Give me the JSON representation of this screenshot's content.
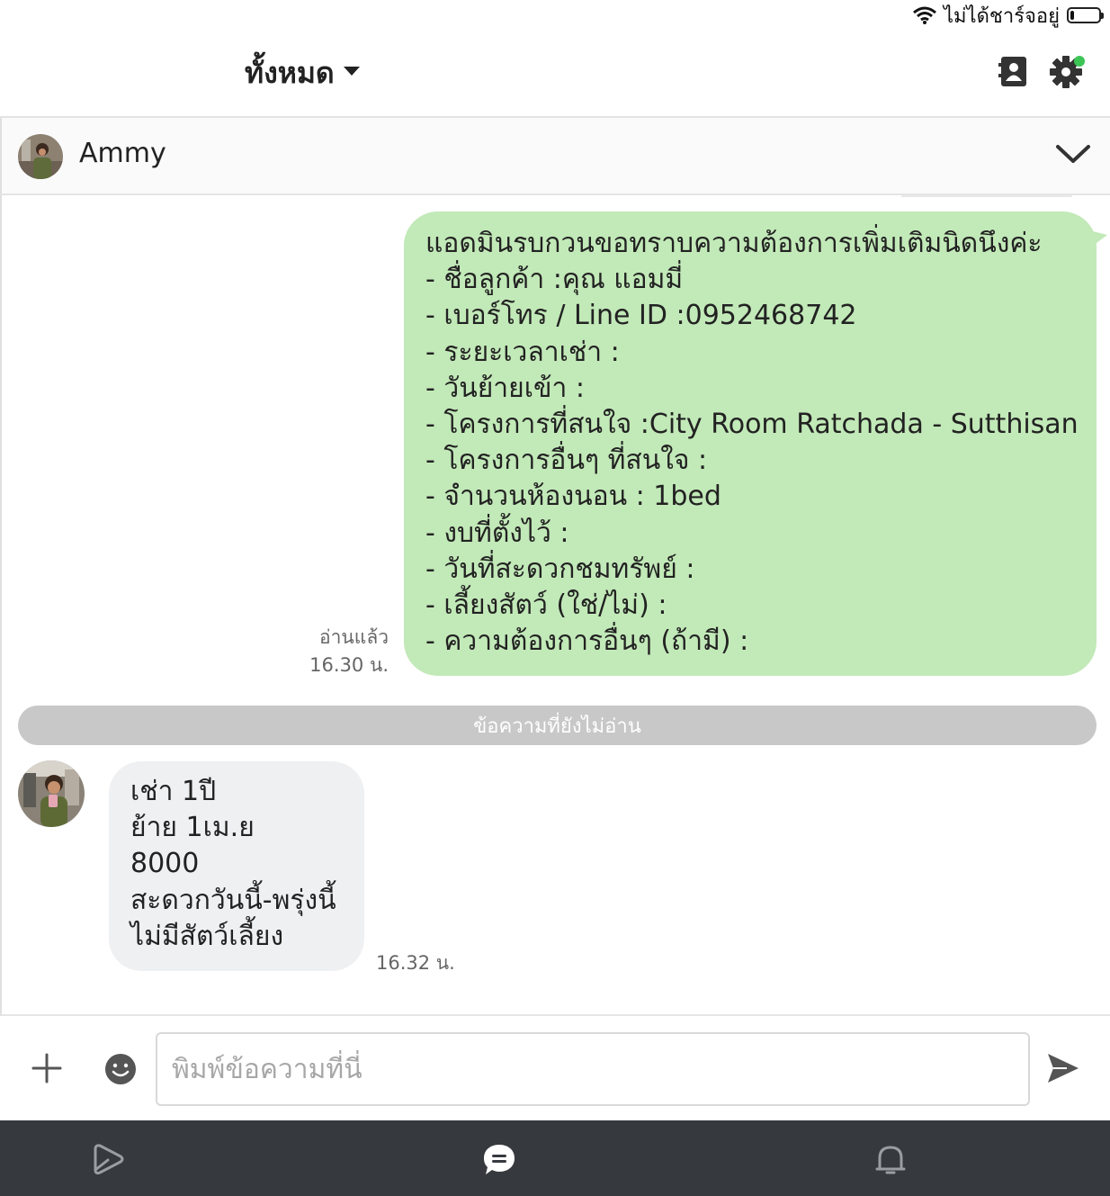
{
  "status_bar": {
    "charging_text": "ไม่ได้ชาร์จอยู่",
    "battery_level": 0.12
  },
  "header": {
    "filter_label": "ทั้งหมด"
  },
  "chat": {
    "contact_name": "Ammy"
  },
  "messages": {
    "outgoing": {
      "lines": [
        "แอดมินรบกวนขอทราบความต้องการเพิ่มเติมนิดนึงค่ะ",
        "- ชื่อลูกค้า :คุณ แอมมี่",
        "- เบอร์โทร / Line ID :0952468742",
        "- ระยะเวลาเช่า :",
        "- วันย้ายเข้า :",
        "- โครงการที่สนใจ :City Room Ratchada - Sutthisan",
        "- โครงการอื่นๆ ที่สนใจ :",
        "- จำนวนห้องนอน : 1bed",
        "- งบที่ตั้งไว้ :",
        "- วันที่สะดวกชมทรัพย์ :",
        "- เลี้ยงสัตว์ (ใช่/ไม่) :",
        "- ความต้องการอื่นๆ (ถ้ามี) :"
      ],
      "read_status": "อ่านแล้ว",
      "time": "16.30 น."
    },
    "unread_label": "ข้อความที่ยังไม่อ่าน",
    "incoming": {
      "lines": [
        "เช่า 1ปี",
        "ย้าย 1เม.ย",
        "8000",
        "สะดวกวันนี้-พรุ่งนี้",
        "ไม่มีสัตว์เลี้ยง"
      ],
      "time": "16.32 น."
    }
  },
  "input": {
    "placeholder": "พิมพ์ข้อความที่นี่",
    "value": ""
  },
  "colors": {
    "outgoing_bubble": "#c2e9b8",
    "incoming_bubble": "#eff0f2",
    "unread_bar": "#c8c8c8",
    "tab_bar": "#363a3f",
    "notification_dot": "#3cc455"
  },
  "icons": {
    "wifi": "wifi-icon",
    "battery": "battery-icon",
    "filter_caret": "caret-down-icon",
    "contacts": "contacts-icon",
    "settings": "gear-icon",
    "expand": "chevron-down-icon",
    "add": "plus-icon",
    "emoji": "emoji-icon",
    "send": "send-icon",
    "tab_home": "home-icon",
    "tab_chats": "chat-icon",
    "tab_notifications": "bell-icon"
  }
}
